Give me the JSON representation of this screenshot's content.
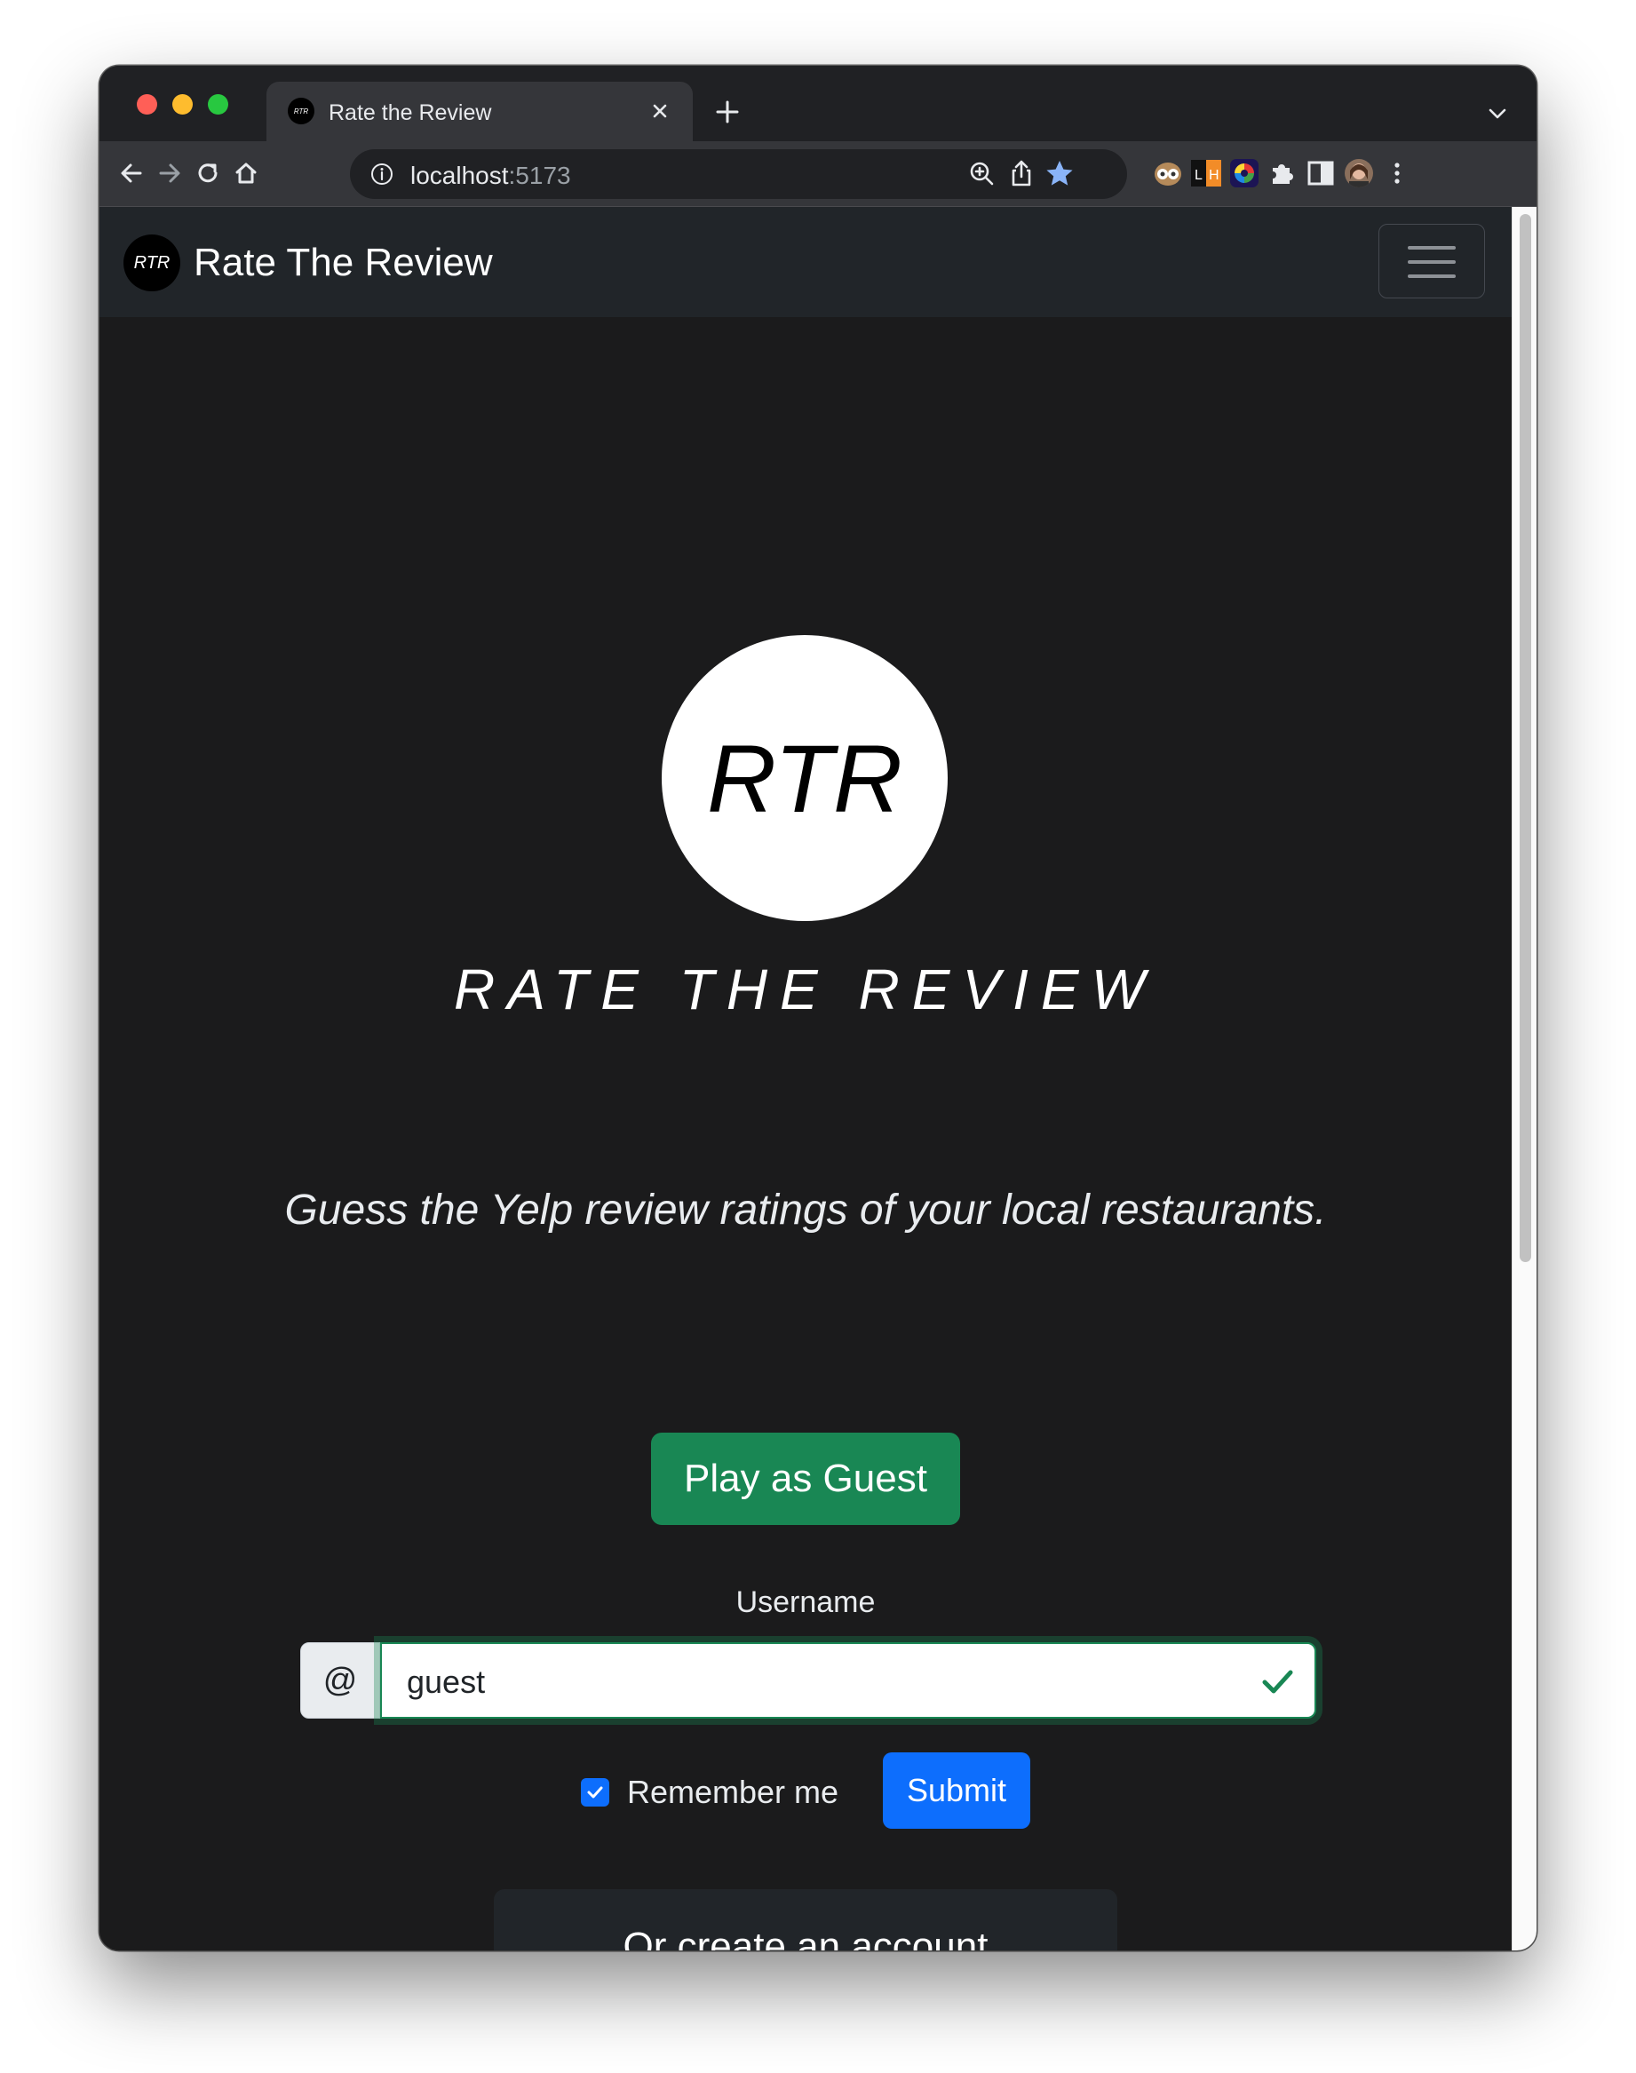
{
  "browser": {
    "tab": {
      "favicon_text": "RTR",
      "title": "Rate the Review"
    },
    "url": {
      "host": "localhost",
      "port": ":5173"
    },
    "colors": {
      "chrome_bg": "#202124",
      "toolbar_bg": "#35363a",
      "bookmark_star": "#8ab4f8"
    },
    "toolbar_icons": [
      "back-icon",
      "forward-icon",
      "reload-icon",
      "home-icon",
      "zoom-icon",
      "share-icon",
      "bookmark-star-icon"
    ],
    "extension_icons": [
      "owl-extension-icon",
      "lh-extension-icon",
      "color-wheel-extension-icon",
      "puzzle-extensions-icon",
      "sidebar-icon",
      "profile-avatar",
      "kebab-menu-icon"
    ]
  },
  "navbar": {
    "logo_text": "RTR",
    "brand": "Rate The Review",
    "toggler_icon": "hamburger-menu-icon"
  },
  "hero": {
    "logo_text": "RTR",
    "title": "RATE THE REVIEW"
  },
  "tagline": "Guess the Yelp review ratings of your local restaurants.",
  "guest_button": "Play as Guest",
  "login": {
    "username_label": "Username",
    "addon": "@",
    "username_value": "guest",
    "remember_label": "Remember me",
    "remember_checked": true,
    "submit_label": "Submit"
  },
  "create_account": "Or create an account",
  "colors": {
    "page_bg": "#1b1b1c",
    "navbar_bg": "#212529",
    "success": "#198754",
    "primary": "#0d6efd"
  }
}
